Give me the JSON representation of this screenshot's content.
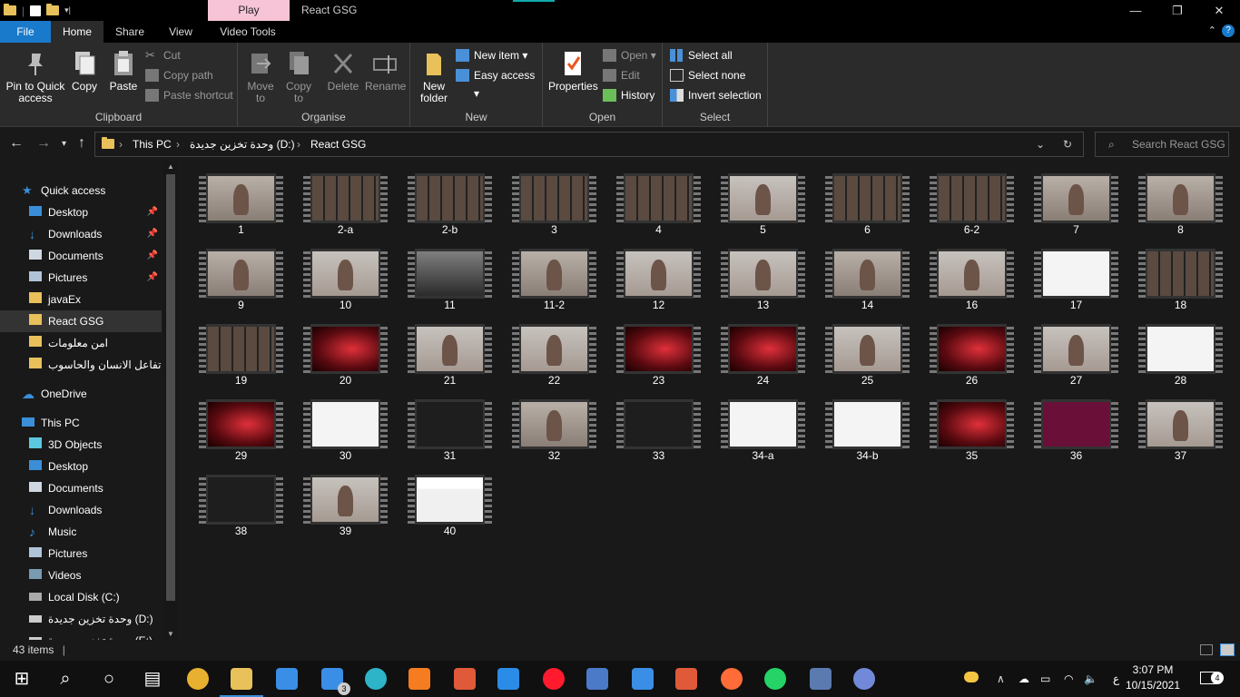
{
  "titlebar": {
    "context_tab": "Play",
    "title": "React GSG",
    "min": "—",
    "restore": "❐",
    "close": "✕"
  },
  "tabs": {
    "file": "File",
    "home": "Home",
    "share": "Share",
    "view": "View",
    "video_tools": "Video Tools"
  },
  "ribbon": {
    "clipboard": {
      "label": "Clipboard",
      "pin": "Pin to Quick access",
      "copy": "Copy",
      "paste": "Paste",
      "cut": "Cut",
      "copy_path": "Copy path",
      "paste_shortcut": "Paste shortcut"
    },
    "organise": {
      "label": "Organise",
      "move_to": "Move to",
      "copy_to": "Copy to",
      "delete": "Delete",
      "rename": "Rename"
    },
    "new": {
      "label": "New",
      "new_folder": "New folder",
      "new_item": "New item",
      "easy_access": "Easy access"
    },
    "open": {
      "label": "Open",
      "properties": "Properties",
      "open": "Open",
      "edit": "Edit",
      "history": "History"
    },
    "select": {
      "label": "Select",
      "select_all": "Select all",
      "select_none": "Select none",
      "invert": "Invert selection"
    }
  },
  "address": {
    "crumbs": [
      "This PC",
      "وحدة تخزين جديدة (D:)",
      "React GSG"
    ],
    "search_placeholder": "Search React GSG"
  },
  "nav": [
    {
      "label": "Quick access",
      "kind": "star"
    },
    {
      "label": "Desktop",
      "kind": "desk",
      "pin": true
    },
    {
      "label": "Downloads",
      "kind": "down",
      "pin": true
    },
    {
      "label": "Documents",
      "kind": "doc",
      "pin": true
    },
    {
      "label": "Pictures",
      "kind": "pic",
      "pin": true
    },
    {
      "label": "javaEx",
      "kind": "folder"
    },
    {
      "label": "React GSG",
      "kind": "folder",
      "selected": true
    },
    {
      "label": "امن معلومات",
      "kind": "folder"
    },
    {
      "label": "تفاعل الانسان والحاسوب",
      "kind": "folder"
    },
    {
      "label": "OneDrive",
      "kind": "cloud"
    },
    {
      "label": "This PC",
      "kind": "pc"
    },
    {
      "label": "3D Objects",
      "kind": "obj"
    },
    {
      "label": "Desktop",
      "kind": "desk"
    },
    {
      "label": "Documents",
      "kind": "doc"
    },
    {
      "label": "Downloads",
      "kind": "down"
    },
    {
      "label": "Music",
      "kind": "music"
    },
    {
      "label": "Pictures",
      "kind": "pic"
    },
    {
      "label": "Videos",
      "kind": "vid"
    },
    {
      "label": "Local Disk (C:)",
      "kind": "disk"
    },
    {
      "label": "وحدة تخزين جديدة (D:)",
      "kind": "disk2"
    },
    {
      "label": "وحدة تخزين جديدة (E:)",
      "kind": "disk2"
    }
  ],
  "files": [
    {
      "name": "1",
      "f": "face"
    },
    {
      "name": "2-a",
      "f": "grid"
    },
    {
      "name": "2-b",
      "f": "grid"
    },
    {
      "name": "3",
      "f": "grid"
    },
    {
      "name": "4",
      "f": "grid"
    },
    {
      "name": "5",
      "f": "face2"
    },
    {
      "name": "6",
      "f": "grid"
    },
    {
      "name": "6-2",
      "f": "grid"
    },
    {
      "name": "7",
      "f": "face"
    },
    {
      "name": "8",
      "f": "face"
    },
    {
      "name": "9",
      "f": "face"
    },
    {
      "name": "10",
      "f": "face2"
    },
    {
      "name": "11",
      "f": "dark"
    },
    {
      "name": "11-2",
      "f": "face"
    },
    {
      "name": "12",
      "f": "face2"
    },
    {
      "name": "13",
      "f": "face2"
    },
    {
      "name": "14",
      "f": "face"
    },
    {
      "name": "16",
      "f": "face2"
    },
    {
      "name": "17",
      "f": "white"
    },
    {
      "name": "18",
      "f": "grid"
    },
    {
      "name": "19",
      "f": "grid"
    },
    {
      "name": "20",
      "f": "red"
    },
    {
      "name": "21",
      "f": "face2"
    },
    {
      "name": "22",
      "f": "face2"
    },
    {
      "name": "23",
      "f": "red"
    },
    {
      "name": "24",
      "f": "red"
    },
    {
      "name": "25",
      "f": "face2"
    },
    {
      "name": "26",
      "f": "red"
    },
    {
      "name": "27",
      "f": "face2"
    },
    {
      "name": "28",
      "f": "white"
    },
    {
      "name": "29",
      "f": "red"
    },
    {
      "name": "30",
      "f": "white"
    },
    {
      "name": "31",
      "f": "code"
    },
    {
      "name": "32",
      "f": "face"
    },
    {
      "name": "33",
      "f": "code"
    },
    {
      "name": "34-a",
      "f": "white"
    },
    {
      "name": "34-b",
      "f": "white"
    },
    {
      "name": "35",
      "f": "red"
    },
    {
      "name": "36",
      "f": "term"
    },
    {
      "name": "37",
      "f": "face2"
    },
    {
      "name": "38",
      "f": "code"
    },
    {
      "name": "39",
      "f": "face2"
    },
    {
      "name": "40",
      "f": "site"
    }
  ],
  "status": {
    "count": "43 items"
  },
  "clock": {
    "time": "3:07 PM",
    "date": "10/15/2021"
  },
  "tray": {
    "lang": "ع",
    "notif_count": "4",
    "mail_badge": "3"
  },
  "taskbar_icons": [
    {
      "name": "start-icon",
      "color": "#ffffff"
    },
    {
      "name": "search-icon",
      "color": "#ffffff"
    },
    {
      "name": "cortana-icon",
      "color": "#ffffff"
    },
    {
      "name": "task-view-icon",
      "color": "#ffffff"
    },
    {
      "name": "chrome-icon",
      "color": "#e8b030"
    },
    {
      "name": "file-explorer-icon",
      "color": "#e8c15a"
    },
    {
      "name": "store-icon",
      "color": "#3a8ee6"
    },
    {
      "name": "mail-icon",
      "color": "#3a8ee6"
    },
    {
      "name": "edge-icon",
      "color": "#2db4c8"
    },
    {
      "name": "xampp-icon",
      "color": "#f57c20"
    },
    {
      "name": "git-icon",
      "color": "#e05a3a"
    },
    {
      "name": "vscode-icon",
      "color": "#2a8ce6"
    },
    {
      "name": "opera-icon",
      "color": "#ff1b2d"
    },
    {
      "name": "jetbrains-icon",
      "color": "#4a7ac8"
    },
    {
      "name": "media-player-icon",
      "color": "#3a8ee6"
    },
    {
      "name": "git-gui-icon",
      "color": "#e05a3a"
    },
    {
      "name": "postman-icon",
      "color": "#ff6c37"
    },
    {
      "name": "whatsapp-icon",
      "color": "#25d366"
    },
    {
      "name": "mysql-icon",
      "color": "#5a7ab0"
    },
    {
      "name": "discord-icon",
      "color": "#7289da"
    }
  ]
}
